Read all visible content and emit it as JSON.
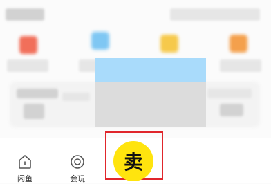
{
  "tabbar": {
    "items": [
      {
        "label": "闲鱼",
        "icon": "home-icon"
      },
      {
        "label": "会玩",
        "icon": "circle-play-icon"
      }
    ],
    "sell": {
      "label": "卖",
      "color": "#ffe40e",
      "highlight_border": "#e0262c"
    }
  },
  "colors": {
    "overlay_top": "#a9dbfb",
    "overlay_bottom": "#dcdcdc"
  }
}
